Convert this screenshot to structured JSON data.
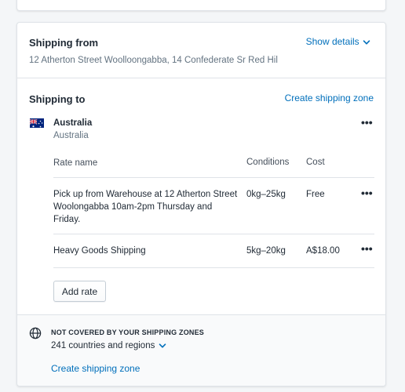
{
  "shipping_from": {
    "title": "Shipping from",
    "address": "12 Atherton Street Woolloongabba, 14 Confederate Sr Red Hil",
    "show_details_label": "Show details"
  },
  "shipping_to": {
    "title": "Shipping to",
    "create_zone_label": "Create shipping zone",
    "zone": {
      "name": "Australia",
      "country": "Australia",
      "flag_icon": "australia-flag-icon"
    },
    "table": {
      "headers": {
        "rate_name": "Rate name",
        "conditions": "Conditions",
        "cost": "Cost"
      },
      "rows": [
        {
          "name_line1": "Pick up from Warehouse at 12 Atherton Street",
          "name_line2": "Woolongabba 10am-2pm Thursday and",
          "name_line3": "Friday.",
          "conditions": "0kg–25kg",
          "cost": "Free"
        },
        {
          "name_line1": "Heavy Goods Shipping",
          "conditions": "5kg–20kg",
          "cost": "A$18.00"
        }
      ]
    },
    "add_rate_label": "Add rate",
    "more_actions_glyph": "•••"
  },
  "not_covered": {
    "heading": "NOT COVERED BY YOUR SHIPPING ZONES",
    "count_label": "241 countries and regions",
    "create_zone_label": "Create shipping zone"
  },
  "colors": {
    "link": "#006fbb",
    "text": "#212b36",
    "subdued": "#637381",
    "border": "#dfe3e8",
    "background": "#f4f6f8"
  }
}
